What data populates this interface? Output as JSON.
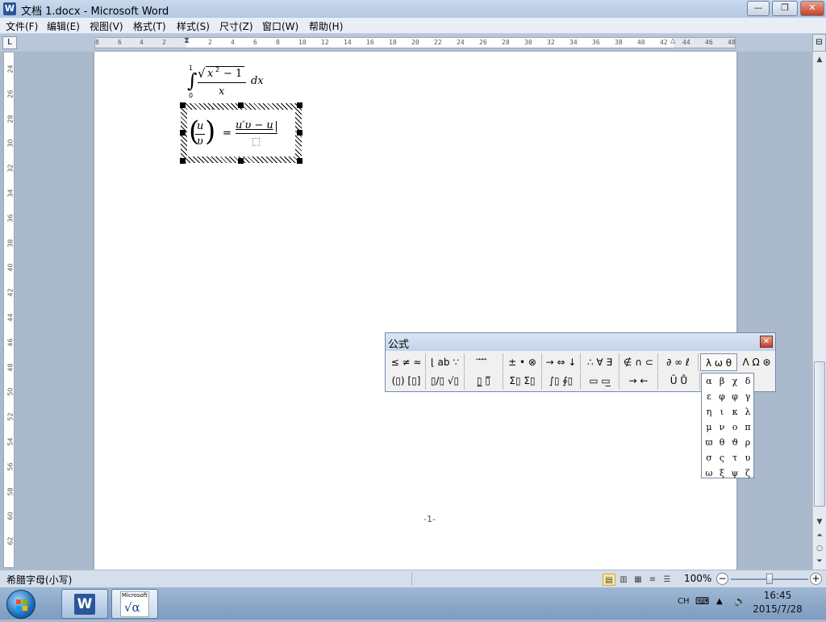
{
  "window": {
    "title": "文档 1.docx - Microsoft Word",
    "app_icon": "W",
    "min": "—",
    "max": "❐",
    "close": "✕"
  },
  "menu": [
    "文件(F)",
    "编辑(E)",
    "视图(V)",
    "格式(T)",
    "样式(S)",
    "尺寸(Z)",
    "窗口(W)",
    "帮助(H)"
  ],
  "ruler": {
    "corner": "L",
    "ticks": [
      "8",
      "6",
      "4",
      "2",
      "2",
      "4",
      "6",
      "8",
      "10",
      "12",
      "14",
      "16",
      "18",
      "20",
      "22",
      "24",
      "26",
      "28",
      "30",
      "32",
      "34",
      "36",
      "38",
      "40",
      "42",
      "44",
      "46",
      "48"
    ],
    "vticks": [
      "24",
      "26",
      "28",
      "30",
      "32",
      "34",
      "36",
      "38",
      "40",
      "42",
      "44",
      "46",
      "48",
      "50",
      "52",
      "54",
      "56",
      "58",
      "60",
      "62"
    ]
  },
  "document": {
    "integral": {
      "upper": "1",
      "lower": "0",
      "radicand_var": "x",
      "radicand_exp": "2",
      "radicand_rest": "− 1",
      "den": "x",
      "dx": "dx"
    },
    "derivative": {
      "num": "u",
      "den": "υ",
      "prime": "′",
      "equals": "=",
      "rhs_num": "u′υ − u",
      "rhs_den": "⬚"
    },
    "page_number": "-1-"
  },
  "equation_toolbar": {
    "title": "公式",
    "close": "✕",
    "row1": [
      "≤ ≠ ≈",
      "⌊ ab ∵",
      "⃗ ⃗ ⃗",
      "± • ⊗",
      "→ ⇔ ↓",
      "∴ ∀ ∃",
      "∉ ∩ ⊂",
      "∂ ∞ ℓ",
      "λ ω θ",
      "Λ Ω ⊛"
    ],
    "row2": [
      "(▯) [▯]",
      "▯/▯ √▯",
      "▯̲ ▯̅",
      "Σ▯ Σ▯",
      "∫▯ ∮▯",
      "▭ ▭̲",
      "→ ←",
      "Ū Ů"
    ]
  },
  "greek_palette": [
    "α",
    "β",
    "χ",
    "δ",
    "ε",
    "φ",
    "φ",
    "γ",
    "η",
    "ι",
    "κ",
    "λ",
    "μ",
    "ν",
    "ο",
    "π",
    "ϖ",
    "θ",
    "ϑ",
    "ρ",
    "σ",
    "ς",
    "τ",
    "υ",
    "ω",
    "ξ",
    "ψ",
    "ζ"
  ],
  "status": {
    "text": "希腊字母(小写)",
    "zoom": "100%",
    "minus": "−",
    "plus": "+"
  },
  "taskbar": {
    "ime": "CH",
    "time": "16:45",
    "date": "2015/7/28",
    "equation_app_label": "Microsoft",
    "equation_app_symbol": "√α"
  }
}
